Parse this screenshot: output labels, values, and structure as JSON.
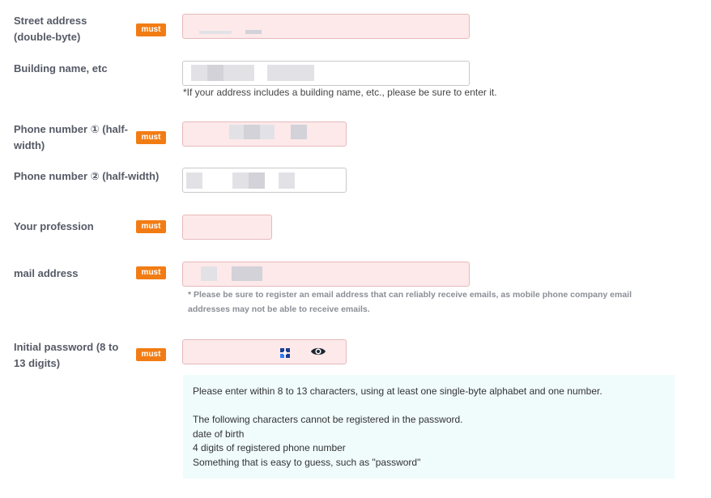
{
  "required_badge": "must",
  "rows": {
    "street": {
      "label_line1": "Street address",
      "label_line2": "(double-byte)"
    },
    "building": {
      "label": "Building name, etc",
      "hint": "*If your address includes a building name, etc., please be sure to enter it."
    },
    "phone1": {
      "label_line1": "Phone number ① (half-",
      "label_line2": "width)"
    },
    "phone2": {
      "label": "Phone number ② (half-width)"
    },
    "profession": {
      "label": "Your profession"
    },
    "mail": {
      "label": "mail address",
      "note_line1": "* Please be sure to register an email address that can reliably receive emails, as mobile phone company email",
      "note_line2": "addresses may not be able to receive emails."
    },
    "password": {
      "label_line1": "Initial password (8 to",
      "label_line2": "13 digits)",
      "icons": [
        "password-manager-icon",
        "eye-icon"
      ]
    }
  },
  "password_info": {
    "line1": "Please enter within 8 to 13 characters, using at least one single-byte alphabet and one number.",
    "line2": "",
    "line3": "The following characters cannot be registered in the password.",
    "line4": "date of birth",
    "line5": "4 digits of registered phone number",
    "line6": "Something that is easy to guess, such as \"password\""
  },
  "colors": {
    "badge": "#f27c14",
    "required_field_bg": "#fde9ea",
    "info_box_bg": "#f0fbfc"
  }
}
